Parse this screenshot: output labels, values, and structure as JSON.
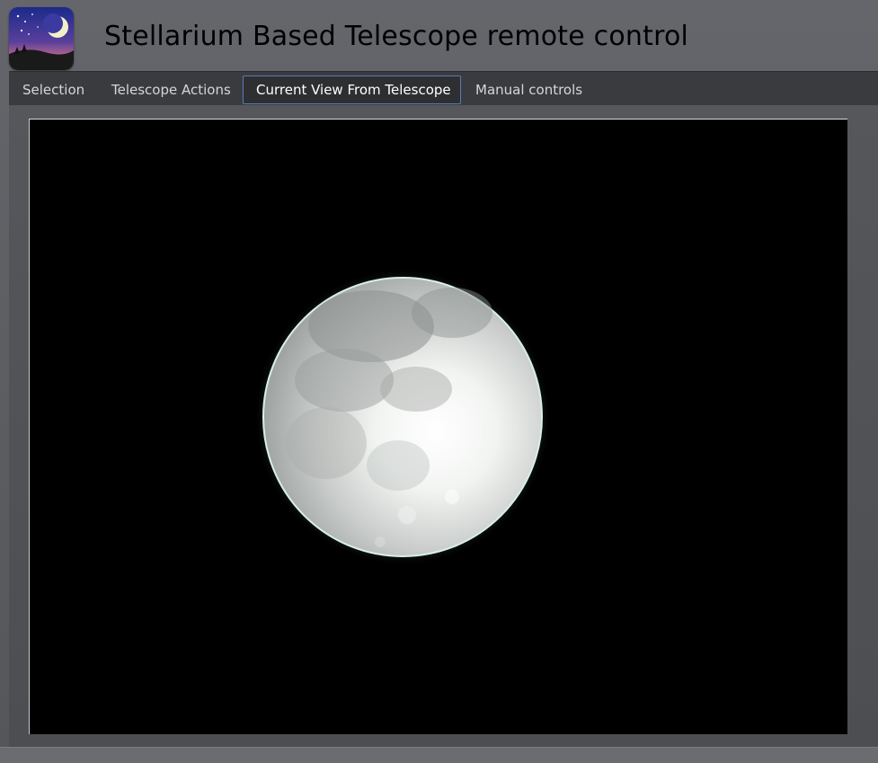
{
  "header": {
    "title": "Stellarium Based Telescope remote control",
    "logo_icon": "stellarium-moon-icon"
  },
  "tabs": [
    {
      "label": "Selection",
      "active": false
    },
    {
      "label": "Telescope Actions",
      "active": false
    },
    {
      "label": "Current View From Telescope",
      "active": true
    },
    {
      "label": "Manual controls",
      "active": false
    }
  ],
  "view": {
    "subject": "moon-image"
  },
  "colors": {
    "tab_active_border": "#5b7bb8",
    "tabbar_bg": "#3a3b3e",
    "page_bg": "#5c5e62"
  }
}
